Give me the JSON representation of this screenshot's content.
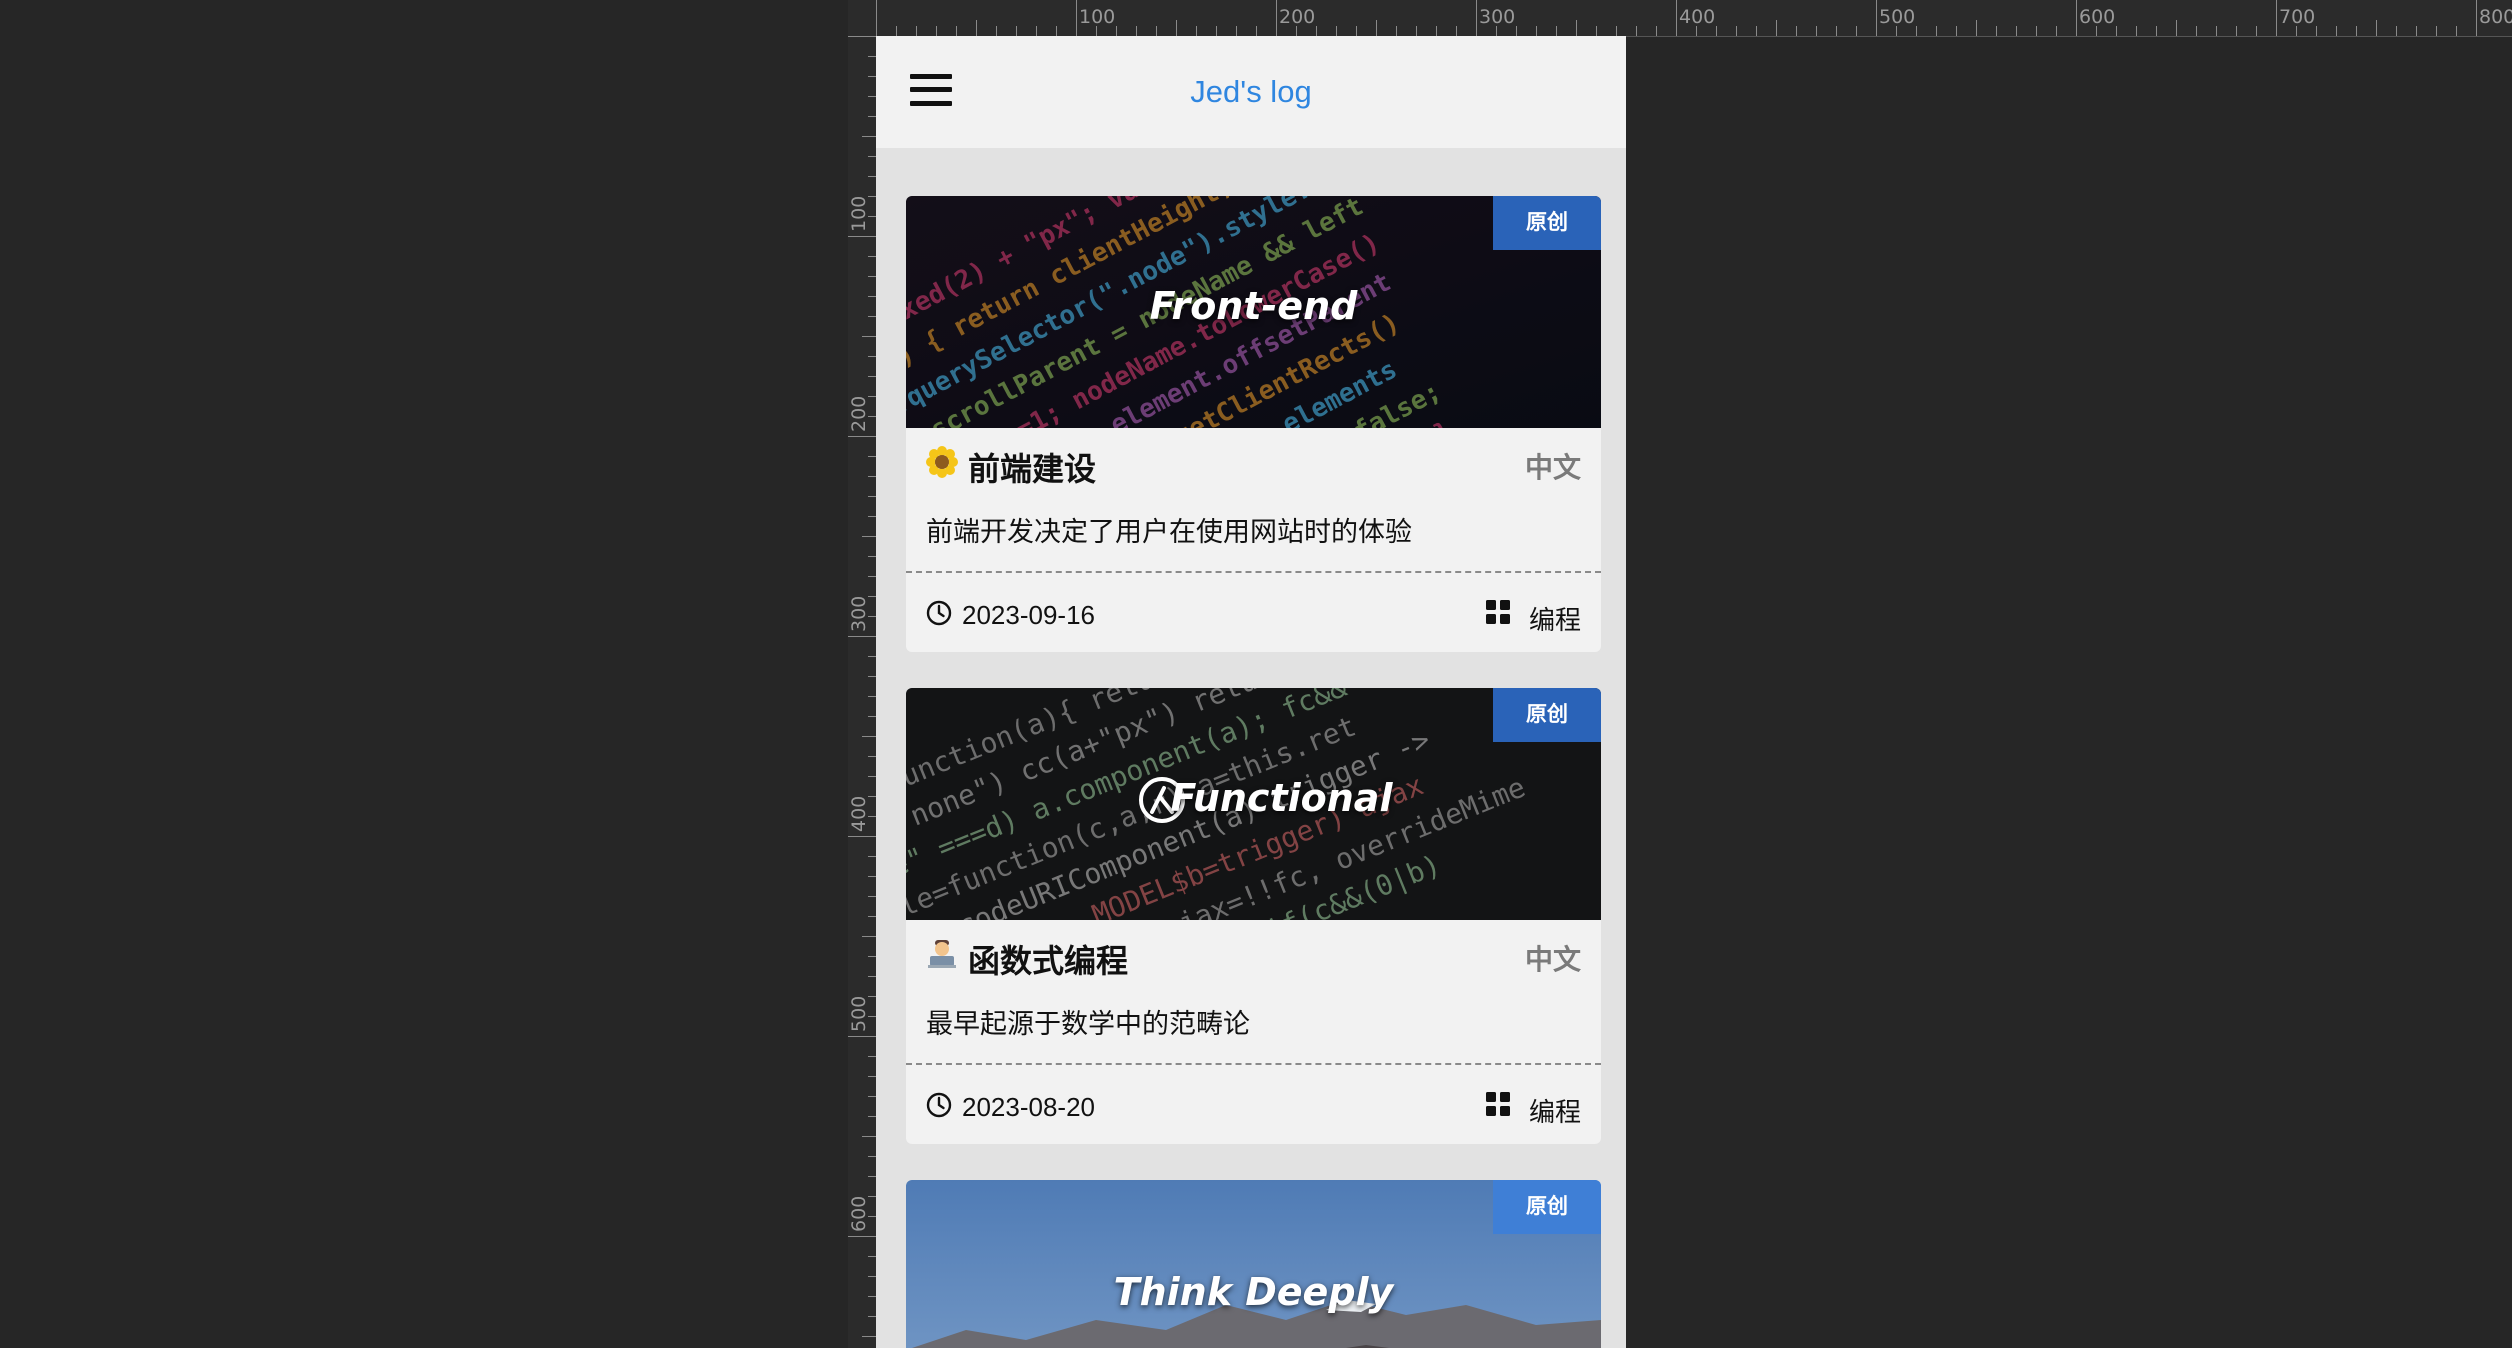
{
  "ruler": {
    "top_labels": [
      "100",
      "200",
      "300",
      "400",
      "500",
      "600",
      "700",
      "800"
    ],
    "left_labels": [
      "100",
      "200",
      "300",
      "400",
      "500",
      "600"
    ]
  },
  "header": {
    "title": "Jed's log",
    "menu_icon": "hamburger-menu-icon",
    "title_color": "#2f86e0"
  },
  "posts": [
    {
      "cover_text": "Front-end",
      "badge": "原创",
      "emoji_icon": "sunflower-icon",
      "title": "前端建设",
      "lang": "中文",
      "description": "前端开发决定了用户在使用网站时的体验",
      "date": "2023-09-16",
      "category": "编程"
    },
    {
      "cover_text": "Functional",
      "badge": "原创",
      "emoji_icon": "technologist-icon",
      "title": "函数式编程",
      "lang": "中文",
      "description": "最早起源于数学中的范畴论",
      "date": "2023-08-20",
      "category": "编程"
    },
    {
      "cover_text": "Think Deeply",
      "badge": "原创"
    }
  ],
  "colors": {
    "badge": "#2a63b8",
    "background": "#262626"
  }
}
